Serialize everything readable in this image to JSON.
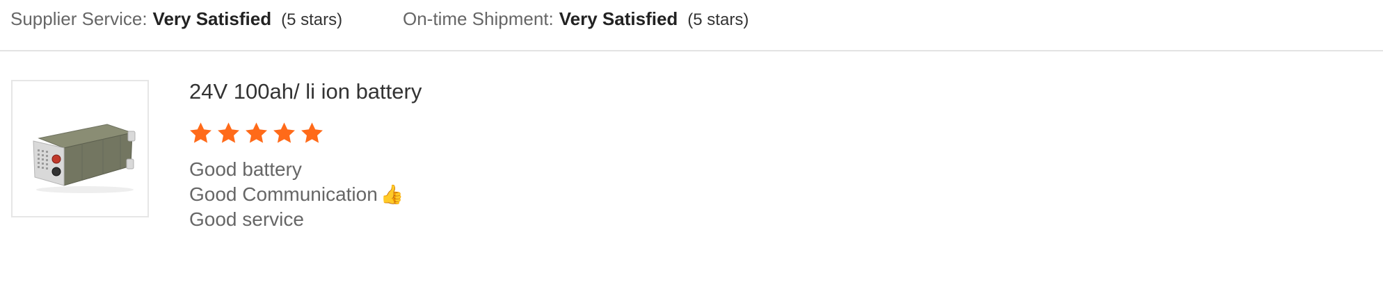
{
  "summary": {
    "supplier_service": {
      "label": "Supplier Service:",
      "value": "Very Satisfied",
      "stars_text": "(5 stars)"
    },
    "ontime_shipment": {
      "label": "On-time Shipment:",
      "value": "Very Satisfied",
      "stars_text": "(5 stars)"
    }
  },
  "review": {
    "product_title": "24V 100ah/ li ion battery",
    "rating": 5,
    "rating_max": 5,
    "star_color": "#ff6a19",
    "comment_lines": [
      "Good battery",
      "Good Communication",
      "Good service"
    ],
    "emoji": "👍",
    "product_image_icon": "battery-pack-icon"
  }
}
